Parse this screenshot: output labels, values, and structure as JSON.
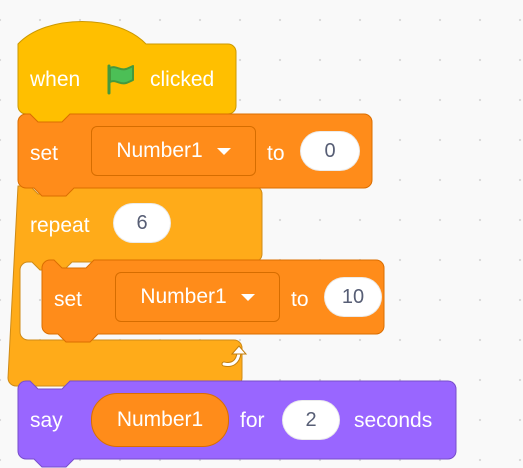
{
  "workspace": {
    "hat_block": {
      "when_text": "when",
      "icon": "green-flag-icon",
      "clicked_text": "clicked"
    },
    "set_block_1": {
      "keyword": "set",
      "variable": "Number1",
      "to_text": "to",
      "value": "0"
    },
    "repeat_block": {
      "keyword": "repeat",
      "count": "6",
      "icon": "loop-arrow-icon"
    },
    "set_block_2": {
      "keyword": "set",
      "variable": "Number1",
      "to_text": "to",
      "value": "10"
    },
    "say_block": {
      "keyword": "say",
      "reporter": "Number1",
      "for_text": "for",
      "seconds_value": "2",
      "seconds_text": "seconds"
    }
  },
  "colors": {
    "events": "#ffbf00",
    "variables": "#ff8c1a",
    "control": "#ffab19",
    "looks": "#9966ff"
  }
}
